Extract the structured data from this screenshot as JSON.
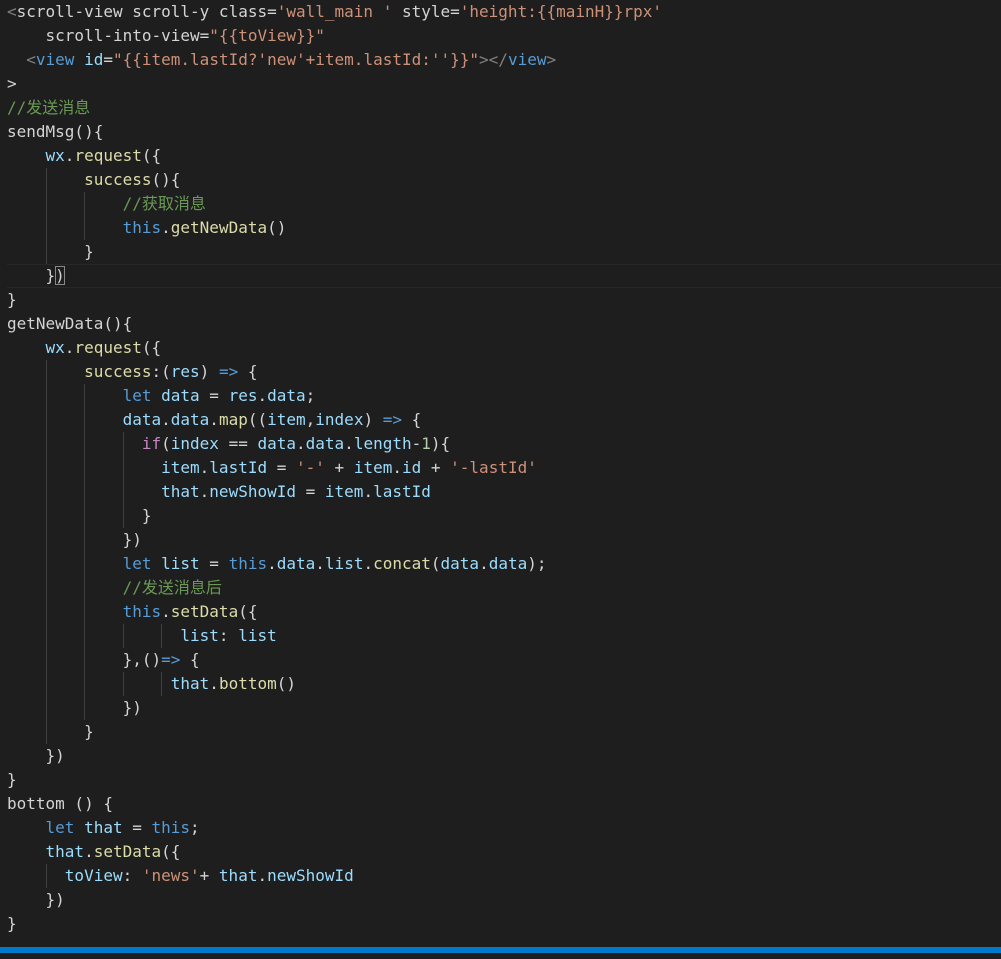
{
  "editor": {
    "colors": {
      "background": "#1e1e1e",
      "status_bar": "#007acc",
      "indent_guide": "#404040"
    },
    "lines": [
      {
        "i": 0,
        "t": [
          [
            "bracket",
            "<"
          ],
          [
            "text",
            "scroll-view scroll-y class="
          ],
          [
            "string",
            "'wall_main '"
          ],
          [
            "text",
            " style="
          ],
          [
            "string",
            "'height:{{mainH}}rpx'"
          ]
        ]
      },
      {
        "i": 4,
        "t": [
          [
            "text",
            "scroll-into-view="
          ],
          [
            "string",
            "\"{{toView}}\""
          ]
        ]
      },
      {
        "i": 2,
        "t": [
          [
            "bracket",
            "<"
          ],
          [
            "tag",
            "view"
          ],
          [
            "attr",
            " id"
          ],
          [
            "punct",
            "="
          ],
          [
            "string",
            "\"{{item.lastId?'new'+item.lastId:''}}\""
          ],
          [
            "bracket",
            ">"
          ],
          [
            "bracket",
            "</"
          ],
          [
            "tag",
            "view"
          ],
          [
            "bracket",
            ">"
          ]
        ]
      },
      {
        "i": 0,
        "t": [
          [
            "punct",
            ">"
          ]
        ]
      },
      {
        "i": 0,
        "t": [
          [
            "comment",
            "//发送消息"
          ]
        ]
      },
      {
        "i": 0,
        "t": [
          [
            "text",
            "sendMsg(){"
          ]
        ]
      },
      {
        "i": 4,
        "t": [
          [
            "ident",
            "wx"
          ],
          [
            "punct",
            "."
          ],
          [
            "func",
            "request"
          ],
          [
            "punct",
            "("
          ],
          [
            "punct",
            "{"
          ]
        ]
      },
      {
        "i": 8,
        "t": [
          [
            "func",
            "success"
          ],
          [
            "punct",
            "(){"
          ]
        ]
      },
      {
        "i": 12,
        "t": [
          [
            "comment",
            "//获取消息"
          ]
        ]
      },
      {
        "i": 12,
        "t": [
          [
            "keyword",
            "this"
          ],
          [
            "punct",
            "."
          ],
          [
            "func",
            "getNewData"
          ],
          [
            "punct",
            "()"
          ]
        ]
      },
      {
        "i": 8,
        "t": [
          [
            "punct",
            "}"
          ]
        ]
      },
      {
        "i": 4,
        "t": [
          [
            "punct",
            "}"
          ],
          [
            "bracketmatch",
            ")"
          ]
        ],
        "current": true
      },
      {
        "i": 0,
        "t": [
          [
            "punct",
            "}"
          ]
        ]
      },
      {
        "i": 0,
        "t": [
          [
            "text",
            "getNewData(){"
          ]
        ]
      },
      {
        "i": 4,
        "t": [
          [
            "ident",
            "wx"
          ],
          [
            "punct",
            "."
          ],
          [
            "func",
            "request"
          ],
          [
            "punct",
            "({"
          ]
        ]
      },
      {
        "i": 8,
        "t": [
          [
            "func",
            "success"
          ],
          [
            "punct",
            ":("
          ],
          [
            "ident",
            "res"
          ],
          [
            "punct",
            ") "
          ],
          [
            "arrow",
            "=>"
          ],
          [
            "punct",
            " {"
          ]
        ]
      },
      {
        "i": 12,
        "t": [
          [
            "keyword",
            "let"
          ],
          [
            "text",
            " "
          ],
          [
            "ident",
            "data"
          ],
          [
            "punct",
            " = "
          ],
          [
            "ident",
            "res"
          ],
          [
            "punct",
            "."
          ],
          [
            "ident",
            "data"
          ],
          [
            "punct",
            ";"
          ]
        ]
      },
      {
        "i": 12,
        "t": [
          [
            "ident",
            "data"
          ],
          [
            "punct",
            "."
          ],
          [
            "ident",
            "data"
          ],
          [
            "punct",
            "."
          ],
          [
            "func",
            "map"
          ],
          [
            "punct",
            "(("
          ],
          [
            "ident",
            "item"
          ],
          [
            "punct",
            ","
          ],
          [
            "ident",
            "index"
          ],
          [
            "punct",
            ") "
          ],
          [
            "arrow",
            "=>"
          ],
          [
            "punct",
            " {"
          ]
        ]
      },
      {
        "i": 14,
        "t": [
          [
            "control",
            "if"
          ],
          [
            "punct",
            "("
          ],
          [
            "ident",
            "index"
          ],
          [
            "punct",
            " == "
          ],
          [
            "ident",
            "data"
          ],
          [
            "punct",
            "."
          ],
          [
            "ident",
            "data"
          ],
          [
            "punct",
            "."
          ],
          [
            "ident",
            "length"
          ],
          [
            "punct",
            "-"
          ],
          [
            "number",
            "1"
          ],
          [
            "punct",
            "){"
          ]
        ]
      },
      {
        "i": 16,
        "t": [
          [
            "ident",
            "item"
          ],
          [
            "punct",
            "."
          ],
          [
            "ident",
            "lastId"
          ],
          [
            "punct",
            " = "
          ],
          [
            "string",
            "'-'"
          ],
          [
            "punct",
            " + "
          ],
          [
            "ident",
            "item"
          ],
          [
            "punct",
            "."
          ],
          [
            "ident",
            "id"
          ],
          [
            "punct",
            " + "
          ],
          [
            "string",
            "'-lastId'"
          ]
        ]
      },
      {
        "i": 16,
        "t": [
          [
            "ident",
            "that"
          ],
          [
            "punct",
            "."
          ],
          [
            "ident",
            "newShowId"
          ],
          [
            "punct",
            " = "
          ],
          [
            "ident",
            "item"
          ],
          [
            "punct",
            "."
          ],
          [
            "ident",
            "lastId"
          ]
        ]
      },
      {
        "i": 14,
        "t": [
          [
            "punct",
            "}"
          ]
        ]
      },
      {
        "i": 12,
        "t": [
          [
            "punct",
            "})"
          ]
        ]
      },
      {
        "i": 12,
        "t": [
          [
            "keyword",
            "let"
          ],
          [
            "text",
            " "
          ],
          [
            "ident",
            "list"
          ],
          [
            "punct",
            " = "
          ],
          [
            "keyword",
            "this"
          ],
          [
            "punct",
            "."
          ],
          [
            "ident",
            "data"
          ],
          [
            "punct",
            "."
          ],
          [
            "ident",
            "list"
          ],
          [
            "punct",
            "."
          ],
          [
            "func",
            "concat"
          ],
          [
            "punct",
            "("
          ],
          [
            "ident",
            "data"
          ],
          [
            "punct",
            "."
          ],
          [
            "ident",
            "data"
          ],
          [
            "punct",
            ");"
          ]
        ]
      },
      {
        "i": 12,
        "t": [
          [
            "comment",
            "//发送消息后"
          ]
        ]
      },
      {
        "i": 12,
        "t": [
          [
            "keyword",
            "this"
          ],
          [
            "punct",
            "."
          ],
          [
            "func",
            "setData"
          ],
          [
            "punct",
            "({"
          ]
        ]
      },
      {
        "i": 18,
        "t": [
          [
            "ident",
            "list"
          ],
          [
            "punct",
            ": "
          ],
          [
            "ident",
            "list"
          ]
        ]
      },
      {
        "i": 12,
        "t": [
          [
            "punct",
            "},()"
          ],
          [
            "arrow",
            "=>"
          ],
          [
            "punct",
            " {"
          ]
        ]
      },
      {
        "i": 17,
        "t": [
          [
            "ident",
            "that"
          ],
          [
            "punct",
            "."
          ],
          [
            "func",
            "bottom"
          ],
          [
            "punct",
            "()"
          ]
        ]
      },
      {
        "i": 12,
        "t": [
          [
            "punct",
            "})"
          ]
        ]
      },
      {
        "i": 8,
        "t": [
          [
            "punct",
            "}"
          ]
        ]
      },
      {
        "i": 4,
        "t": [
          [
            "punct",
            "})"
          ]
        ]
      },
      {
        "i": 0,
        "t": [
          [
            "punct",
            "}"
          ]
        ]
      },
      {
        "i": 0,
        "t": [
          [
            "text",
            "bottom () {"
          ]
        ]
      },
      {
        "i": 4,
        "t": [
          [
            "keyword",
            "let"
          ],
          [
            "text",
            " "
          ],
          [
            "ident",
            "that"
          ],
          [
            "punct",
            " = "
          ],
          [
            "keyword",
            "this"
          ],
          [
            "punct",
            ";"
          ]
        ]
      },
      {
        "i": 4,
        "t": [
          [
            "ident",
            "that"
          ],
          [
            "punct",
            "."
          ],
          [
            "func",
            "setData"
          ],
          [
            "punct",
            "({"
          ]
        ]
      },
      {
        "i": 6,
        "t": [
          [
            "ident",
            "toView"
          ],
          [
            "punct",
            ": "
          ],
          [
            "string",
            "'news'"
          ],
          [
            "punct",
            "+ "
          ],
          [
            "ident",
            "that"
          ],
          [
            "punct",
            "."
          ],
          [
            "ident",
            "newShowId"
          ]
        ]
      },
      {
        "i": 4,
        "t": [
          [
            "punct",
            "})"
          ]
        ]
      },
      {
        "i": 0,
        "t": [
          [
            "punct",
            "}"
          ]
        ]
      }
    ]
  }
}
